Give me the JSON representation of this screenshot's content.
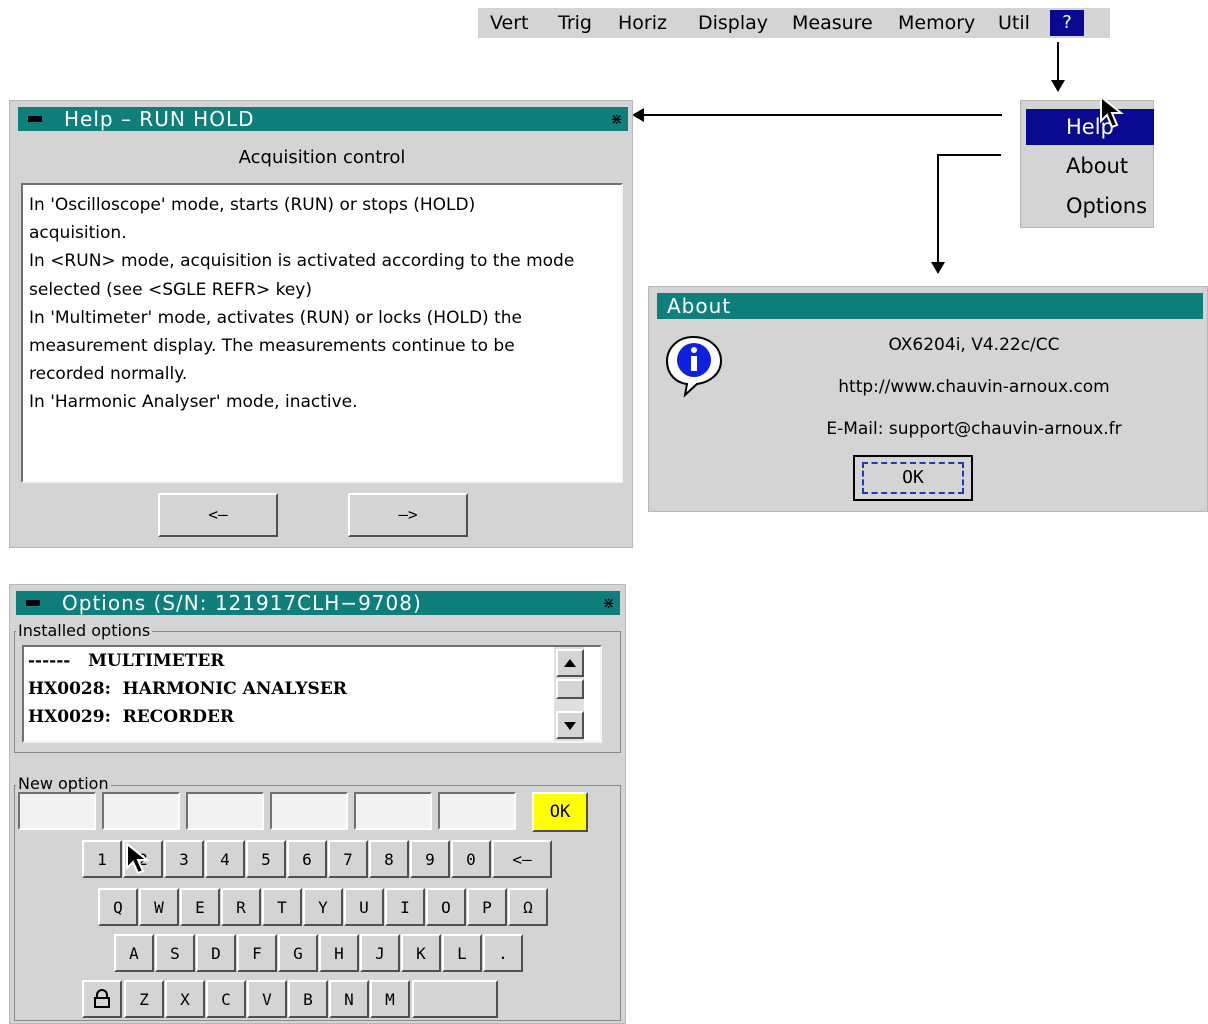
{
  "menubar": {
    "items": [
      "Vert",
      "Trig",
      "Horiz",
      "Display",
      "Measure",
      "Memory",
      "Util"
    ],
    "help_label": "?"
  },
  "help_menu": {
    "items": [
      "Help",
      "About",
      "Options"
    ]
  },
  "help_window": {
    "title": "Help – RUN HOLD",
    "subtitle": "Acquisition control",
    "text_lines": [
      "In 'Oscilloscope' mode, starts (RUN) or stops (HOLD)",
      "acquisition.",
      "In <RUN> mode, acquisition is activated according to the mode",
      "selected (see <SGLE REFR> key)",
      "In 'Multimeter' mode, activates (RUN) or locks (HOLD) the",
      "measurement display. The measurements continue to be",
      "recorded normally.",
      "In 'Harmonic Analyser' mode, inactive."
    ],
    "prev_label": "<–",
    "next_label": "–>"
  },
  "about_window": {
    "title": "About",
    "version": "OX6204i, V4.22c/CC",
    "website": "http://www.chauvin-arnoux.com",
    "email": "E-Mail:  support@chauvin-arnoux.fr",
    "ok_label": "OK"
  },
  "options_window": {
    "title": "Options (S/N: 121917CLH−9708)",
    "installed_label": "Installed options",
    "installed": [
      "------   MULTIMETER",
      "HX0028:  HARMONIC ANALYSER",
      "HX0029:  RECORDER"
    ],
    "new_option_label": "New option",
    "ok_label": "OK",
    "keyboard": {
      "row1": [
        "1",
        "2",
        "3",
        "4",
        "5",
        "6",
        "7",
        "8",
        "9",
        "0",
        "<–"
      ],
      "row2": [
        "Q",
        "W",
        "E",
        "R",
        "T",
        "Y",
        "U",
        "I",
        "O",
        "P",
        "Ω"
      ],
      "row3": [
        "A",
        "S",
        "D",
        "F",
        "G",
        "H",
        "J",
        "K",
        "L",
        "."
      ],
      "row4": [
        "Z",
        "X",
        "C",
        "V",
        "B",
        "N",
        "M"
      ]
    }
  },
  "colors": {
    "titlebar": "#0e7f7a",
    "menu_highlight": "#0a0a90",
    "ok_yellow": "#ffff00",
    "panel": "#d4d4d4"
  }
}
